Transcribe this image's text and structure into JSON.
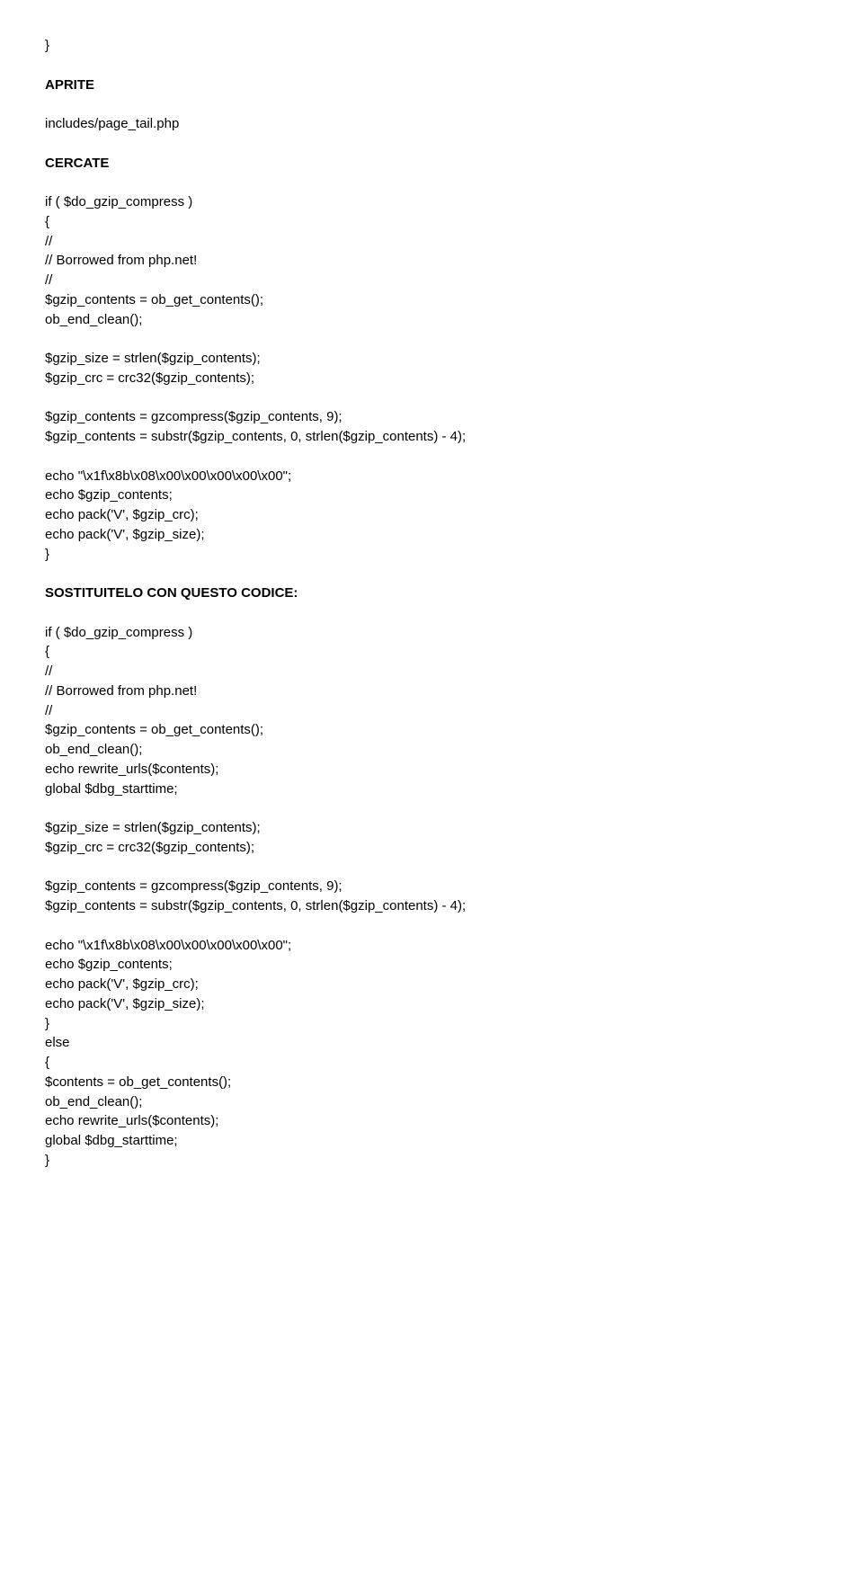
{
  "l01": "}",
  "l02": "APRITE",
  "l03": "includes/page_tail.php",
  "l04": "CERCATE",
  "l05": "if ( $do_gzip_compress )",
  "l06": "{",
  "l07": "//",
  "l08": "// Borrowed from php.net!",
  "l09": "//",
  "l10": "$gzip_contents = ob_get_contents();",
  "l11": "ob_end_clean();",
  "l12": "$gzip_size = strlen($gzip_contents);",
  "l13": "$gzip_crc = crc32($gzip_contents);",
  "l14": "$gzip_contents = gzcompress($gzip_contents, 9);",
  "l15": "$gzip_contents = substr($gzip_contents, 0, strlen($gzip_contents) - 4);",
  "l16": "echo \"\\x1f\\x8b\\x08\\x00\\x00\\x00\\x00\\x00\";",
  "l17": "echo $gzip_contents;",
  "l18": "echo pack('V', $gzip_crc);",
  "l19": "echo pack('V', $gzip_size);",
  "l20": "}",
  "l21": "SOSTITUITELO CON QUESTO CODICE:",
  "l22": "if ( $do_gzip_compress )",
  "l23": "{",
  "l24": "//",
  "l25": "// Borrowed from php.net!",
  "l26": "//",
  "l27": "$gzip_contents = ob_get_contents();",
  "l28": "ob_end_clean();",
  "l29": "echo rewrite_urls($contents);",
  "l30": "global $dbg_starttime;",
  "l31": "$gzip_size = strlen($gzip_contents);",
  "l32": "$gzip_crc = crc32($gzip_contents);",
  "l33": "$gzip_contents = gzcompress($gzip_contents, 9);",
  "l34": "$gzip_contents = substr($gzip_contents, 0, strlen($gzip_contents) - 4);",
  "l35": "echo \"\\x1f\\x8b\\x08\\x00\\x00\\x00\\x00\\x00\";",
  "l36": "echo $gzip_contents;",
  "l37": "echo pack('V', $gzip_crc);",
  "l38": "echo pack('V', $gzip_size);",
  "l39": "}",
  "l40": "else",
  "l41": "{",
  "l42": "$contents = ob_get_contents();",
  "l43": "ob_end_clean();",
  "l44": "echo rewrite_urls($contents);",
  "l45": "global $dbg_starttime;",
  "l46": "}"
}
